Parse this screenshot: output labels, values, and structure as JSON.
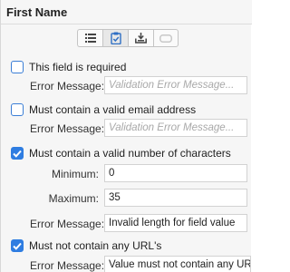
{
  "panel": {
    "title": "First Name"
  },
  "toolbar": {
    "buttons": [
      {
        "icon": "list-icon",
        "active": false
      },
      {
        "icon": "clipboard-check-icon",
        "active": true
      },
      {
        "icon": "tray-download-icon",
        "active": false
      },
      {
        "icon": "rounded-rect-icon",
        "active": false
      }
    ]
  },
  "validations": {
    "required": {
      "label": "This field is required",
      "checked": false,
      "error_label": "Error Message:",
      "error_value": "",
      "error_placeholder": "Validation Error Message..."
    },
    "email": {
      "label": "Must contain a valid email address",
      "checked": false,
      "error_label": "Error Message:",
      "error_value": "",
      "error_placeholder": "Validation Error Message..."
    },
    "length": {
      "label": "Must contain a valid number of characters",
      "checked": true,
      "min_label": "Minimum:",
      "min_value": "0",
      "max_label": "Maximum:",
      "max_value": "35",
      "error_label": "Error Message:",
      "error_value": "Invalid length for field value"
    },
    "no_urls": {
      "label": "Must not contain any URL's",
      "checked": true,
      "error_label": "Error Message:",
      "error_value": "Value must not contain any URL's"
    }
  },
  "colors": {
    "accent": "#2f7de1",
    "background": "#f6f6f6"
  }
}
